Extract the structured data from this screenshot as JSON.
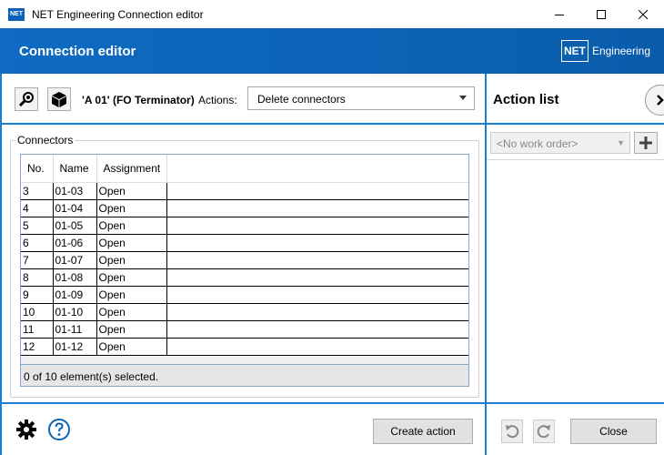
{
  "window": {
    "logo": "NET",
    "title": "NET Engineering Connection editor",
    "controls": [
      "minimize-icon",
      "maximize-icon",
      "close-icon"
    ]
  },
  "header": {
    "title": "Connection editor",
    "brand_box": "NET",
    "brand_text": "Engineering",
    "color": "#0b63b6"
  },
  "toolbar": {
    "object_label": "'A 01' (FO Terminator)",
    "actions_label": "Actions:",
    "action_selected": "Delete connectors"
  },
  "connectors": {
    "group_title": "Connectors",
    "columns": [
      "No.",
      "Name",
      "Assignment"
    ],
    "rows": [
      [
        "3",
        "01-03",
        "Open"
      ],
      [
        "4",
        "01-04",
        "Open"
      ],
      [
        "5",
        "01-05",
        "Open"
      ],
      [
        "6",
        "01-06",
        "Open"
      ],
      [
        "7",
        "01-07",
        "Open"
      ],
      [
        "8",
        "01-08",
        "Open"
      ],
      [
        "9",
        "01-09",
        "Open"
      ],
      [
        "10",
        "01-10",
        "Open"
      ],
      [
        "11",
        "01-11",
        "Open"
      ],
      [
        "12",
        "01-12",
        "Open"
      ]
    ],
    "status": "0 of 10 element(s) selected."
  },
  "bottom": {
    "create_action_label": "Create action",
    "close_label": "Close"
  },
  "action_list": {
    "title": "Action list",
    "work_order_placeholder": "<No work order>"
  }
}
